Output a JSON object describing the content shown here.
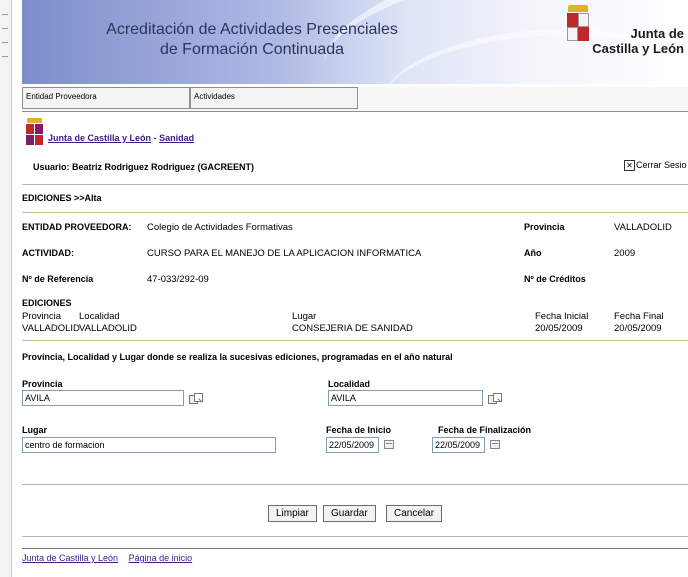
{
  "header": {
    "title_line1": "Acreditación de Actividades Presenciales",
    "title_line2": "de Formación Continuada",
    "brand_line1": "Junta de",
    "brand_line2": "Castilla y León"
  },
  "tabs": [
    {
      "label": "Entidad Proveedora"
    },
    {
      "label": "Actividades"
    }
  ],
  "breadcrumb": {
    "home": "Junta de Castilla y León",
    "separator": "-",
    "section": "Sanidad"
  },
  "user": {
    "label": "Usuario: Beatriz Rodriguez Rodriguez (GACREENT)"
  },
  "logout": {
    "label": "Cerrar Sesión",
    "shown": "Cerrar Sesio"
  },
  "section_title": "EDICIONES >>Alta",
  "info": {
    "entidad_label": "ENTIDAD PROVEEDORA:",
    "entidad_value": "Colegio de Actividades Formativas",
    "provincia_label": "Provincia",
    "provincia_value": "VALLADOLID",
    "actividad_label": "ACTIVIDAD:",
    "actividad_value": "CURSO PARA EL MANEJO DE LA APLICACION INFORMATICA",
    "anio_label": "Año",
    "anio_value": "2009",
    "referencia_label": "Nº de Referencia",
    "referencia_value": "47-033/292-09",
    "creditos_label": "Nº de Créditos",
    "creditos_value": ""
  },
  "ediciones": {
    "title": "EDICIONES",
    "columns": [
      "Provincia",
      "Localidad",
      "Lugar",
      "Fecha Inicial",
      "Fecha Final"
    ],
    "rows": [
      [
        "VALLADOLID",
        "VALLADOLID",
        "CONSEJERIA DE SANIDAD",
        "20/05/2009",
        "20/05/2009"
      ]
    ]
  },
  "form": {
    "instructions": "Provincia, Localidad y Lugar donde se realiza la sucesivas ediciones, programadas en el año natural",
    "provincia_label": "Provincia",
    "provincia_value": "AVILA",
    "localidad_label": "Localidad",
    "localidad_value": "AVILA",
    "lugar_label": "Lugar",
    "lugar_value": "centro de formacion",
    "fecha_inicio_label": "Fecha de Inicio",
    "fecha_inicio_value": "22/05/2009",
    "fecha_fin_label": "Fecha de Finalización",
    "fecha_fin_value": "22/05/2009"
  },
  "buttons": {
    "limpiar": "Limpiar",
    "guardar": "Guardar",
    "cancelar": "Cancelar"
  },
  "footer": {
    "link1": "Junta de Castilla y León",
    "link2": "Página de inicio"
  },
  "colors": {
    "banner_dark": "#7d8ecb",
    "link": "#3b1c86",
    "crest_gold": "#e0b326",
    "crest_red": "#c0272d",
    "crest_purple": "#7a1f6e"
  }
}
